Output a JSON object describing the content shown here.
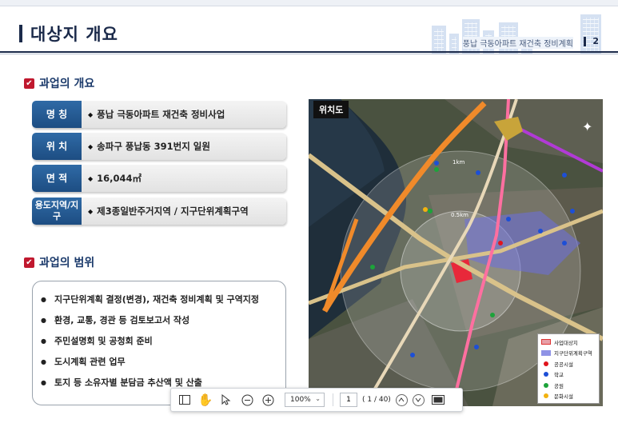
{
  "header": {
    "title": "대상지 개요",
    "project_name": "풍납 극동아파트 재건축 정비계획",
    "page_number": "2"
  },
  "overview": {
    "heading": "과업의 개요",
    "rows": [
      {
        "label": "명 칭",
        "value": "풍납 극동아파트 재건축 정비사업"
      },
      {
        "label": "위 치",
        "value": "송파구 풍납동 391번지 일원"
      },
      {
        "label": "면 적",
        "value": "16,044㎡"
      },
      {
        "label": "용도지역/지구",
        "value": "제3종일반주거지역 / 지구단위계획구역"
      }
    ]
  },
  "scope": {
    "heading": "과업의 범위",
    "items": [
      "지구단위계획 결정(변경), 재건축 정비계획 및 구역지정",
      "환경, 교통, 경관 등 검토보고서 작성",
      "주민설명회 및 공청회 준비",
      "도시계획 관련 업무",
      "토지 등 소유자별 분담금 추산액 및 산출"
    ]
  },
  "map": {
    "tag": "위치도",
    "labels": {
      "ring_1km": "1km",
      "ring_05km": "0.5km"
    },
    "legend": [
      {
        "label": "사업대상지",
        "color": "#e8a0a8",
        "kind": "swatch"
      },
      {
        "label": "지구단위계획구역",
        "color": "#8f93e6",
        "kind": "swatch"
      },
      {
        "label": "공공시설",
        "color": "#e0141c",
        "kind": "dot"
      },
      {
        "label": "학교",
        "color": "#1d4fd6",
        "kind": "dot"
      },
      {
        "label": "공원",
        "color": "#1da33a",
        "kind": "dot"
      },
      {
        "label": "문화시설",
        "color": "#f2b20f",
        "kind": "dot"
      }
    ]
  },
  "viewer_toolbar": {
    "zoom": "100%",
    "current_page": "1",
    "page_total": "( 1 / 40)"
  }
}
